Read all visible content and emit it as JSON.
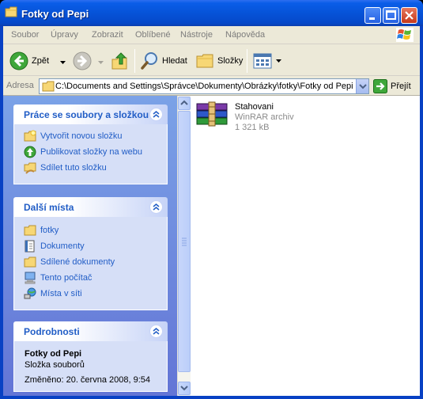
{
  "window": {
    "title": "Fotky od Pepi"
  },
  "menu": {
    "items": [
      "Soubor",
      "Úpravy",
      "Zobrazit",
      "Oblíbené",
      "Nástroje",
      "Nápověda"
    ]
  },
  "toolbar": {
    "back_label": "Zpět",
    "search_label": "Hledat",
    "folders_label": "Složky"
  },
  "address": {
    "label": "Adresa",
    "path": "C:\\Documents and Settings\\Správce\\Dokumenty\\Obrázky\\fotky\\Fotky od Pepi",
    "go_label": "Přejít"
  },
  "tasks_panel": {
    "title": "Práce se soubory a složkou",
    "items": [
      {
        "label": "Vytvořit novou složku",
        "icon": "new-folder-icon"
      },
      {
        "label": "Publikovat složky na webu",
        "icon": "publish-web-icon"
      },
      {
        "label": "Sdílet tuto složku",
        "icon": "share-folder-icon"
      }
    ]
  },
  "places_panel": {
    "title": "Další místa",
    "items": [
      {
        "label": "fotky",
        "icon": "folder-icon"
      },
      {
        "label": "Dokumenty",
        "icon": "documents-icon"
      },
      {
        "label": "Sdílené dokumenty",
        "icon": "folder-icon"
      },
      {
        "label": "Tento počítač",
        "icon": "computer-icon"
      },
      {
        "label": "Místa v síti",
        "icon": "network-icon"
      }
    ]
  },
  "details_panel": {
    "title": "Podrobnosti",
    "name": "Fotky od Pepi",
    "type": "Složka souborů",
    "modified": "Změněno: 20. června 2008, 9:54"
  },
  "files": [
    {
      "name": "Stahovani",
      "type": "WinRAR archiv",
      "size": "1 321 kB",
      "icon": "winrar-archive-icon"
    }
  ],
  "colors": {
    "titlebar": "#0653d8",
    "link": "#215dc6",
    "pane_top": "#7ba2e7",
    "pane_bottom": "#6375d6"
  }
}
